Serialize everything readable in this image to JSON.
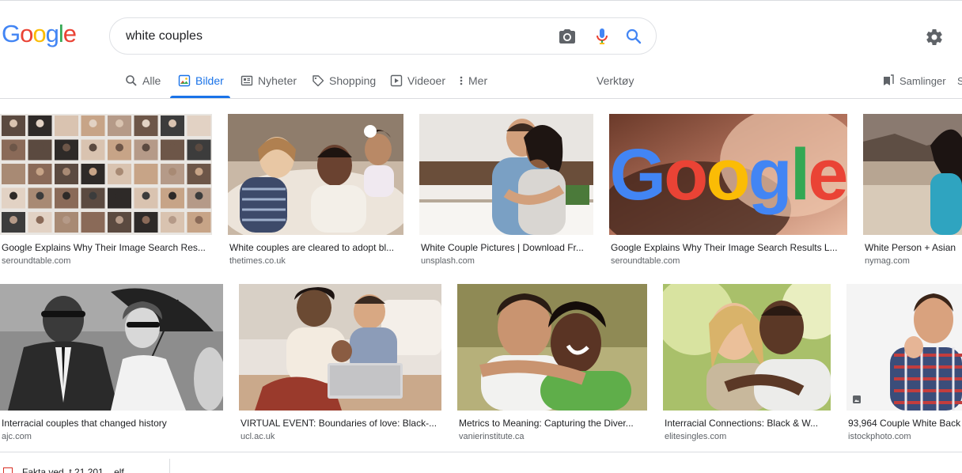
{
  "logo": {
    "letters": [
      "G",
      "o",
      "o",
      "g",
      "l",
      "e"
    ],
    "colors": [
      "#4285f4",
      "#ea4335",
      "#fbbc05",
      "#4285f4",
      "#34a853",
      "#ea4335"
    ]
  },
  "search": {
    "query": "white couples",
    "icons": [
      "camera-icon",
      "mic-icon",
      "search-icon"
    ]
  },
  "tabs": [
    {
      "label": "Alle",
      "icon": "search-icon"
    },
    {
      "label": "Bilder",
      "icon": "image-icon",
      "active": true
    },
    {
      "label": "Nyheter",
      "icon": "news-icon"
    },
    {
      "label": "Shopping",
      "icon": "tag-icon"
    },
    {
      "label": "Videoer",
      "icon": "play-icon"
    },
    {
      "label": "Mer",
      "icon": "more-vert-icon"
    },
    {
      "label": "Verktøy"
    },
    {
      "label": "Samlinger",
      "icon": "bookmark-icon"
    },
    {
      "label": "S"
    }
  ],
  "accent": "#1a73e8",
  "results": [
    {
      "title": "Google Explains Why Their Image Search Res...",
      "source": "seroundtable.com"
    },
    {
      "title": "White couples are cleared to adopt bl...",
      "source": "thetimes.co.uk"
    },
    {
      "title": "White Couple Pictures | Download Fr...",
      "source": "unsplash.com"
    },
    {
      "title": "Google Explains Why Their Image Search Results L...",
      "source": "seroundtable.com",
      "overlay": "Google"
    },
    {
      "title": "White Person + Asian",
      "source": "nymag.com"
    },
    {
      "title": "Interracial couples that changed history",
      "source": "ajc.com"
    },
    {
      "title": "VIRTUAL EVENT: Boundaries of love: Black-...",
      "source": "ucl.ac.uk"
    },
    {
      "title": "Metrics to Meaning: Capturing the Diver...",
      "source": "vanierinstitute.ca"
    },
    {
      "title": "Interracial Connections: Black & W...",
      "source": "elitesingles.com"
    },
    {
      "title": "93,964 Couple White Back",
      "source": "istockphoto.com"
    }
  ],
  "footer": {
    "text": "Fakta ved. t 21 201 ...elf..."
  }
}
